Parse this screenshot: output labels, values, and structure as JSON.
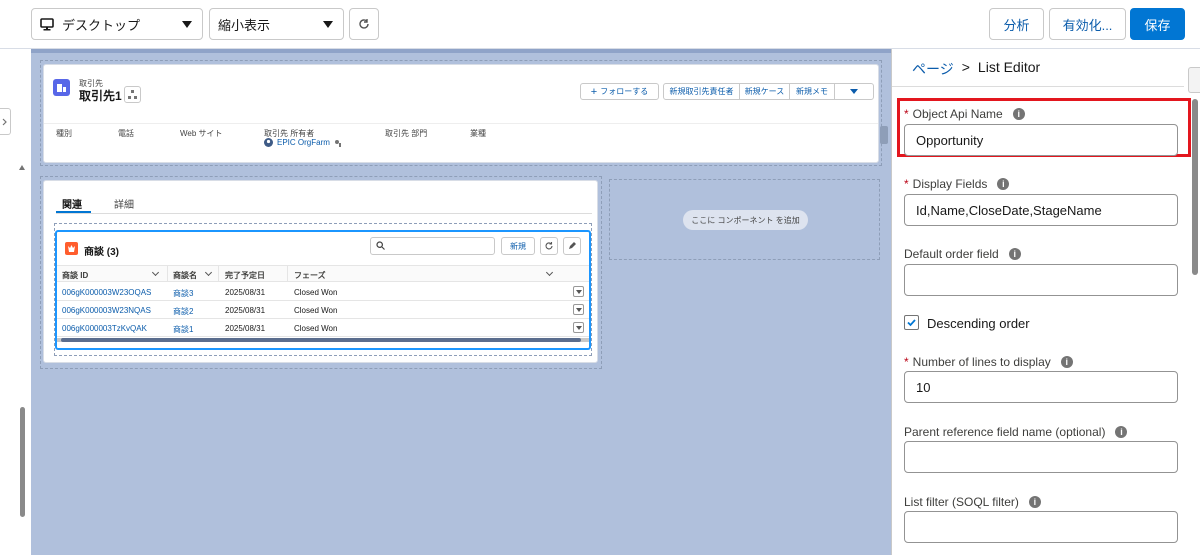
{
  "toolbar": {
    "device_label": "デスクトップ",
    "view_label": "縮小表示",
    "analyze_label": "分析",
    "activate_label": "有効化...",
    "save_label": "保存"
  },
  "record": {
    "object_label": "取引先",
    "name": "取引先1",
    "actions": [
      "フォローする",
      "新規取引先責任者",
      "新規ケース",
      "新規メモ"
    ],
    "fields": [
      {
        "label": "種別",
        "value": ""
      },
      {
        "label": "電話",
        "value": ""
      },
      {
        "label": "Web サイト",
        "value": ""
      },
      {
        "label": "取引先 所有者",
        "value": "EPIC OrgFarm"
      },
      {
        "label": "取引先 部門",
        "value": ""
      },
      {
        "label": "業種",
        "value": ""
      }
    ]
  },
  "tabs": [
    "関連",
    "詳細"
  ],
  "related_list": {
    "title": "商談 (3)",
    "new_label": "新規",
    "search_placeholder": "",
    "columns": [
      "商談 ID",
      "商談名",
      "完了予定日",
      "フェーズ"
    ],
    "rows": [
      {
        "id": "006gK000003W23OQAS",
        "name": "商談3",
        "date": "2025/08/31",
        "stage": "Closed Won"
      },
      {
        "id": "006gK000003W23NQAS",
        "name": "商談2",
        "date": "2025/08/31",
        "stage": "Closed Won"
      },
      {
        "id": "006gK000003TzKvQAK",
        "name": "商談1",
        "date": "2025/08/31",
        "stage": "Closed Won"
      }
    ]
  },
  "add_component_label": "ここに コンポーネント を追加",
  "panel": {
    "breadcrumb_root": "ページ",
    "breadcrumb_sep": ">",
    "breadcrumb_current": "List Editor",
    "fields": [
      {
        "label": "Object Api Name",
        "required": true,
        "value": "Opportunity"
      },
      {
        "label": "Display Fields",
        "required": true,
        "value": "Id,Name,CloseDate,StageName"
      },
      {
        "label": "Default order field",
        "required": false,
        "value": ""
      },
      {
        "label": "Number of lines to display",
        "required": true,
        "value": "10"
      },
      {
        "label": "Parent reference field name (optional)",
        "required": false,
        "value": ""
      },
      {
        "label": "List filter (SOQL filter)",
        "required": false,
        "value": ""
      }
    ],
    "descending_label": "Descending order",
    "descending_checked": true,
    "required_mark": "*",
    "info_glyph": "i"
  },
  "colors": {
    "brand": "#0176d3",
    "highlight": "#e3161e",
    "canvas": "#b0c0dc"
  }
}
